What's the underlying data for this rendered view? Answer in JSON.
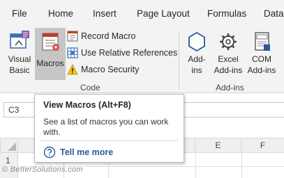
{
  "ribbon_tabs": [
    "File",
    "Home",
    "Insert",
    "Page Layout",
    "Formulas",
    "Data"
  ],
  "code_group": {
    "visual_basic": [
      "Visual",
      "Basic"
    ],
    "macros": "Macros",
    "record_macro": "Record Macro",
    "use_relative_references": "Use Relative References",
    "macro_security": "Macro Security",
    "group_label": "Code"
  },
  "addins_group": {
    "addins": [
      "Add-",
      "ins"
    ],
    "excel_addins": [
      "Excel",
      "Add-ins"
    ],
    "com_addins": [
      "COM",
      "Add-ins"
    ],
    "group_label": "Add-ins"
  },
  "name_box": "C3",
  "columns": [
    "E",
    "F"
  ],
  "rows": [
    "1"
  ],
  "tooltip": {
    "title": "View Macros (Alt+F8)",
    "description": "See a list of macros you can work with.",
    "help_link": "Tell me more"
  },
  "watermark": "© BetterSolutions.com",
  "colors": {
    "ribbon_bg": "#f3f3f3",
    "selected_button": "#c6c6c6",
    "link_blue": "#2b579a",
    "icon_blue": "#2b579a"
  },
  "icons": {
    "visual_basic": "visual-basic-icon",
    "macros": "macros-icon",
    "record_macro": "record-macro-icon",
    "relative_references": "grid-icon",
    "macro_security": "warning-icon",
    "addins": "hexagon-icon",
    "excel_addins": "gear-icon",
    "com_addins": "com-addins-icon",
    "help": "question-circle-icon"
  }
}
